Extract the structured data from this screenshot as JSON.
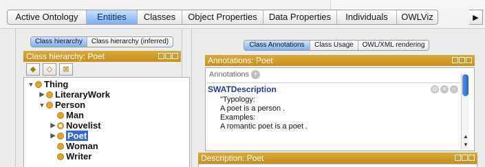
{
  "tabs": [
    {
      "label": "Active Ontology",
      "width": 115
    },
    {
      "label": "Entities",
      "width": 74,
      "active": true
    },
    {
      "label": "Classes",
      "width": 65
    },
    {
      "label": "Object Properties",
      "width": 118
    },
    {
      "label": "Data Properties",
      "width": 107
    },
    {
      "label": "Individuals",
      "width": 87
    },
    {
      "label": "OWLViz",
      "width": 59
    }
  ],
  "tab_more": "▶",
  "class_view_switch": {
    "items": [
      "Class hierarchy",
      "Class hierarchy (inferred)"
    ],
    "selected": "Class hierarchy"
  },
  "class_hierarchy_header": "Class hierarchy: Poet",
  "toolbar_icons": [
    "add-subclass-icon",
    "add-sibling-icon",
    "delete-class-icon"
  ],
  "tree": [
    {
      "label": "Thing",
      "depth": 0,
      "toggle": "▼"
    },
    {
      "label": "LiteraryWork",
      "depth": 1,
      "toggle": "▶"
    },
    {
      "label": "Person",
      "depth": 1,
      "toggle": "▼"
    },
    {
      "label": "Man",
      "depth": 2,
      "toggle": ""
    },
    {
      "label": "Novelist",
      "depth": 2,
      "toggle": "▶",
      "equivalent": true
    },
    {
      "label": "Poet",
      "depth": 2,
      "toggle": "▶",
      "selected": true
    },
    {
      "label": "Woman",
      "depth": 2,
      "toggle": ""
    },
    {
      "label": "Writer",
      "depth": 2,
      "toggle": ""
    }
  ],
  "right_view_switch": {
    "items": [
      "Class Annotations",
      "Class Usage",
      "OWL/XML rendering"
    ],
    "selected": "Class Annotations"
  },
  "annotations_header": "Annotations: Poet",
  "annotations_label": "Annotations",
  "annotation": {
    "property": "SWATDescription",
    "lines": [
      "\"Typology:",
      "A poet is a person .",
      "Examples:",
      "A romantic poet is a poet ."
    ]
  },
  "description_header": "Description: Poet",
  "colors": {
    "view_header": "#c8901c",
    "selected_tab": "#78b1f3",
    "selection": "#2f6bd8",
    "class_dot": "#e0a530"
  }
}
